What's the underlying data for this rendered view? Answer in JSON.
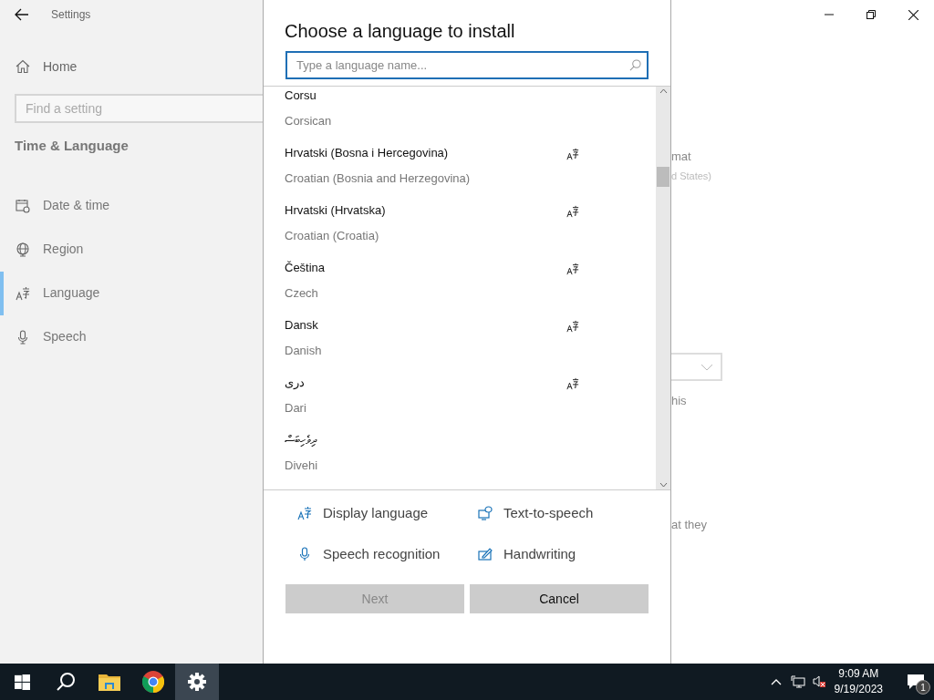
{
  "window": {
    "title": "Settings"
  },
  "sidebar": {
    "home": "Home",
    "search": {
      "placeholder": "Find a setting"
    },
    "section": "Time & Language",
    "items": [
      {
        "label": "Date & time",
        "kind": "calendar",
        "selected": false
      },
      {
        "label": "Region",
        "kind": "globe",
        "selected": false
      },
      {
        "label": "Language",
        "kind": "language",
        "selected": true
      },
      {
        "label": "Speech",
        "kind": "mic",
        "selected": false
      }
    ]
  },
  "background_fragments": [
    {
      "text": "mat",
      "kind": "text"
    },
    {
      "text": "d States)",
      "kind": "subtext"
    },
    {
      "kind": "dropdown"
    },
    {
      "text": "his",
      "kind": "text"
    },
    {
      "text": "at they",
      "kind": "text"
    }
  ],
  "dialog": {
    "title": "Choose a language to install",
    "search": {
      "placeholder": "Type a language name..."
    },
    "languages": [
      {
        "name": "Corsu",
        "english": "Corsican",
        "display_language": false
      },
      {
        "name": "Hrvatski (Bosna i Hercegovina)",
        "english": "Croatian (Bosnia and Herzegovina)",
        "display_language": true
      },
      {
        "name": "Hrvatski (Hrvatska)",
        "english": "Croatian (Croatia)",
        "display_language": true
      },
      {
        "name": "Čeština",
        "english": "Czech",
        "display_language": true
      },
      {
        "name": "Dansk",
        "english": "Danish",
        "display_language": true
      },
      {
        "name": "دری",
        "english": "Dari",
        "display_language": true
      },
      {
        "name": "ދިވެހިބަސް",
        "english": "Divehi",
        "display_language": false
      }
    ],
    "legend": [
      {
        "kind": "display",
        "label": "Display language"
      },
      {
        "kind": "tts",
        "label": "Text-to-speech"
      },
      {
        "kind": "speech",
        "label": "Speech recognition"
      },
      {
        "kind": "handwriting",
        "label": "Handwriting"
      }
    ],
    "buttons": [
      {
        "label": "Next",
        "disabled": true
      },
      {
        "label": "Cancel",
        "disabled": false
      }
    ]
  },
  "taskbar": {
    "apps": [
      {
        "kind": "start",
        "selected": false
      },
      {
        "kind": "search",
        "selected": false
      },
      {
        "kind": "folder",
        "selected": false
      },
      {
        "kind": "browser",
        "selected": false
      },
      {
        "kind": "settings",
        "selected": true
      }
    ],
    "time": "9:09 AM",
    "date": "9/19/2023",
    "notifications": "1"
  }
}
